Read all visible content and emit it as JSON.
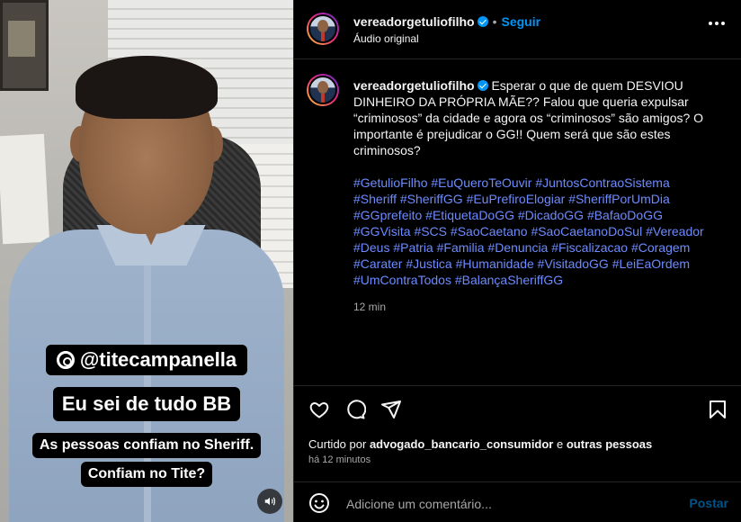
{
  "video": {
    "captions": {
      "handle": "@titecampanella",
      "line1": "Eu sei de tudo BB",
      "line2": "As pessoas confiam no Sheriff.",
      "line3": "Confiam no Tite?"
    },
    "sound_icon": "speaker-icon"
  },
  "header": {
    "username": "vereadorgetuliofilho",
    "separator": "•",
    "follow_label": "Seguir",
    "audio_label": "Áudio original",
    "more_icon": "more-icon"
  },
  "post": {
    "username": "vereadorgetuliofilho",
    "caption": "Esperar o que de quem DESVIOU DINHEIRO DA PRÓPRIA MÃE?? Falou que queria expulsar “criminosos” da cidade e agora os “criminosos” são amigos? O importante é prejudicar o GG!! Quem será que são estes criminosos?",
    "hashtags": [
      "#GetulioFilho",
      "#EuQueroTeOuvir",
      "#JuntosContraoSistema",
      "#Sheriff",
      "#SheriffGG",
      "#EuPrefiroElogiar",
      "#SheriffPorUmDia",
      "#GGprefeito",
      "#EtiquetaDoGG",
      "#DicadoGG",
      "#BafaoDoGG",
      "#GGVisita",
      "#SCS",
      "#SaoCaetano",
      "#SaoCaetanoDoSul",
      "#Vereador",
      "#Deus",
      "#Patria",
      "#Familia",
      "#Denuncia",
      "#Fiscalizacao",
      "#Coragem",
      "#Carater",
      "#Justica",
      "#Humanidade",
      "#VisitadoGG",
      "#LeiEaOrdem",
      "#UmContraTodos",
      "#BalançaSheriffGG"
    ],
    "time": "12 min"
  },
  "actions": {
    "like_icon": "heart-icon",
    "comment_icon": "comment-icon",
    "share_icon": "share-icon",
    "save_icon": "bookmark-icon"
  },
  "likes": {
    "prefix": "Curtido por",
    "user": "advogado_bancario_consumidor",
    "conj": "e",
    "others": "outras pessoas",
    "time": "há 12 minutos"
  },
  "add_comment": {
    "placeholder": "Adicione um comentário...",
    "post_label": "Postar",
    "emoji_icon": "emoji-icon"
  },
  "colors": {
    "accent": "#0095f6",
    "hashtag": "#6d8bff",
    "background": "#000000",
    "muted": "#a8a8a8"
  }
}
